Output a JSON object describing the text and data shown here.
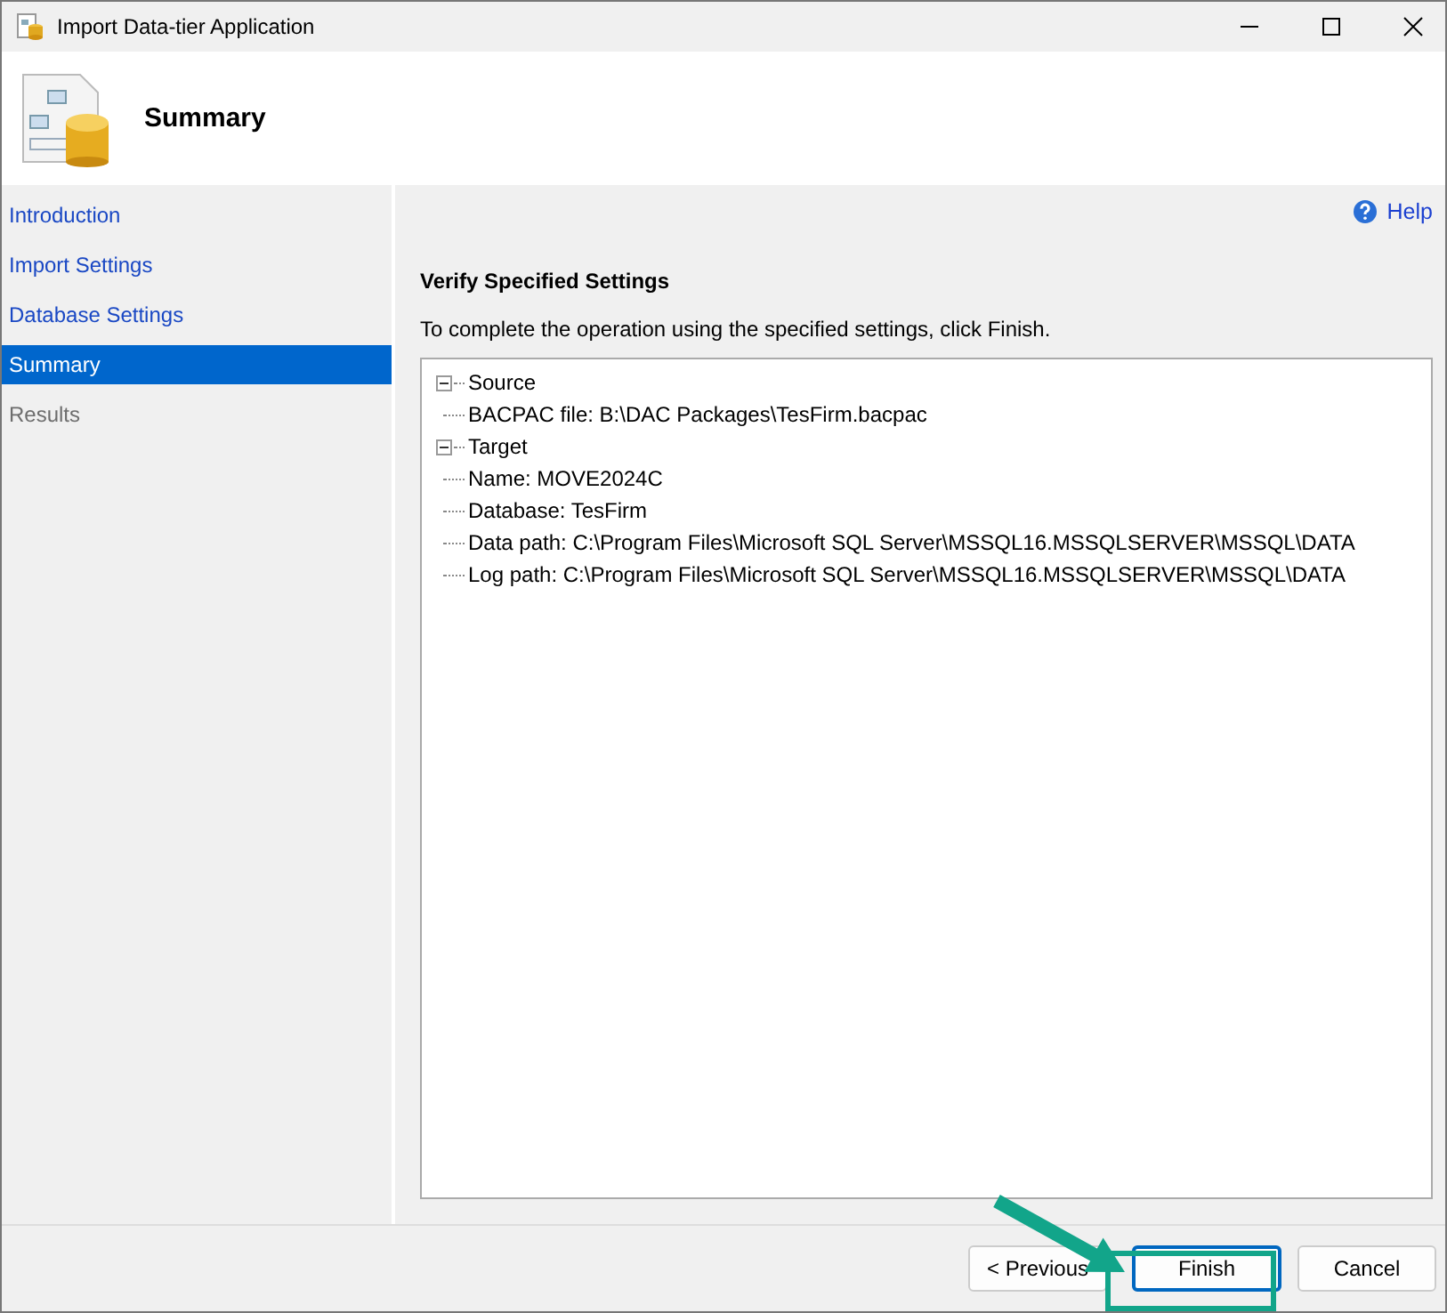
{
  "window": {
    "title": "Import Data-tier Application"
  },
  "header": {
    "title": "Summary"
  },
  "nav": [
    {
      "label": "Introduction",
      "selected": false,
      "disabled": false
    },
    {
      "label": "Import Settings",
      "selected": false,
      "disabled": false
    },
    {
      "label": "Database Settings",
      "selected": false,
      "disabled": false
    },
    {
      "label": "Summary",
      "selected": true,
      "disabled": false
    },
    {
      "label": "Results",
      "selected": false,
      "disabled": true
    }
  ],
  "help": "Help",
  "heading": "Verify Specified Settings",
  "description": "To complete the operation using the specified settings, click Finish.",
  "tree": [
    {
      "label": "Source",
      "expanded": true,
      "children": [
        {
          "label": "BACPAC file: B:\\DAC Packages\\TesFirm.bacpac"
        }
      ]
    },
    {
      "label": "Target",
      "expanded": true,
      "children": [
        {
          "label": "Name: MOVE2024C"
        },
        {
          "label": "Database: TesFirm"
        },
        {
          "label": "Data path: C:\\Program Files\\Microsoft SQL Server\\MSSQL16.MSSQLSERVER\\MSSQL\\DATA"
        },
        {
          "label": "Log path: C:\\Program Files\\Microsoft SQL Server\\MSSQL16.MSSQLSERVER\\MSSQL\\DATA"
        }
      ]
    }
  ],
  "buttons": [
    {
      "label": "< Previous",
      "kind": "normal"
    },
    {
      "label": "Finish",
      "kind": "default"
    },
    {
      "label": "Cancel",
      "kind": "normal"
    }
  ]
}
